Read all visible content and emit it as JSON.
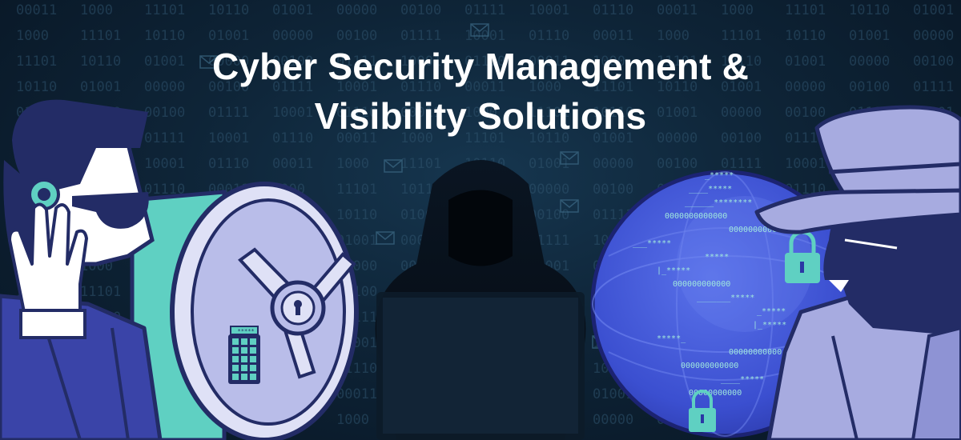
{
  "banner": {
    "headline_line1": "Cyber Security Management &",
    "headline_line2": "Visibility Solutions"
  },
  "globe": {
    "code_lines": [
      "_*****",
      "____*****",
      "______********",
      "0000000000000",
      "0000000000000",
      "___*****",
      "*****",
      "|_*****",
      "000000000000",
      "_______*****",
      "_*****",
      "|_*****",
      "*****_",
      "00000000000",
      "000000000000",
      "____*****",
      "00000000000"
    ]
  },
  "safe": {
    "display": "_*****"
  },
  "background": {
    "binary": [
      "00011",
      "1000",
      "11101",
      "10110",
      "01001",
      "00000",
      "00100",
      "01111",
      "10001",
      "01110"
    ]
  },
  "colors": {
    "accent_teal": "#5fd0c2",
    "navy": "#232c66",
    "periwinkle": "#a7abe0",
    "globe_blue": "#3b4fd0"
  }
}
